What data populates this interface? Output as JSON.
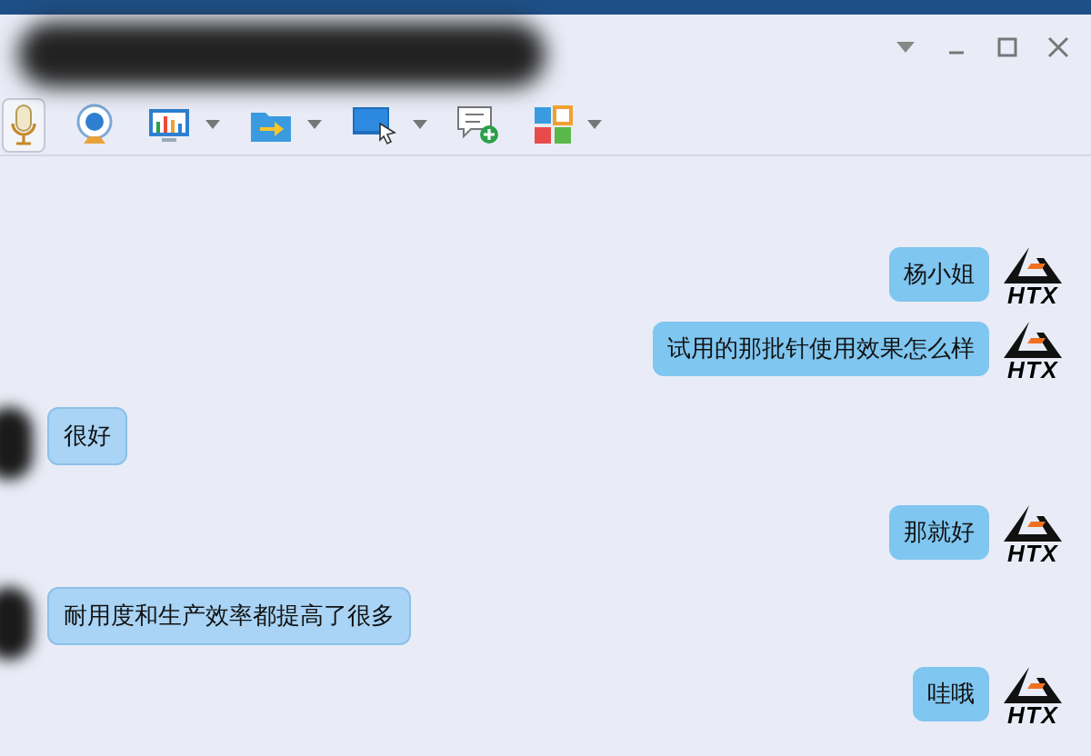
{
  "toolbar": {
    "items": [
      {
        "kind": "mic",
        "dropdown": false,
        "selected": true
      },
      {
        "kind": "camera",
        "dropdown": false,
        "selected": false
      },
      {
        "kind": "screen-chart",
        "dropdown": true,
        "selected": false
      },
      {
        "kind": "folder",
        "dropdown": true,
        "selected": false
      },
      {
        "kind": "screen-share",
        "dropdown": true,
        "selected": false
      },
      {
        "kind": "message-add",
        "dropdown": false,
        "selected": false
      },
      {
        "kind": "apps",
        "dropdown": true,
        "selected": false
      }
    ]
  },
  "messages": [
    {
      "kind": "sent",
      "text": "杨小姐",
      "avatar": "HTX"
    },
    {
      "kind": "sent",
      "text": "试用的那批针使用效果怎么样",
      "avatar": "HTX"
    },
    {
      "kind": "received",
      "text": "很好"
    },
    {
      "kind": "sent",
      "text": "那就好",
      "avatar": "HTX"
    },
    {
      "kind": "received",
      "text": "耐用度和生产效率都提高了很多"
    },
    {
      "kind": "sent",
      "text": "哇哦",
      "avatar": "HTX"
    }
  ]
}
